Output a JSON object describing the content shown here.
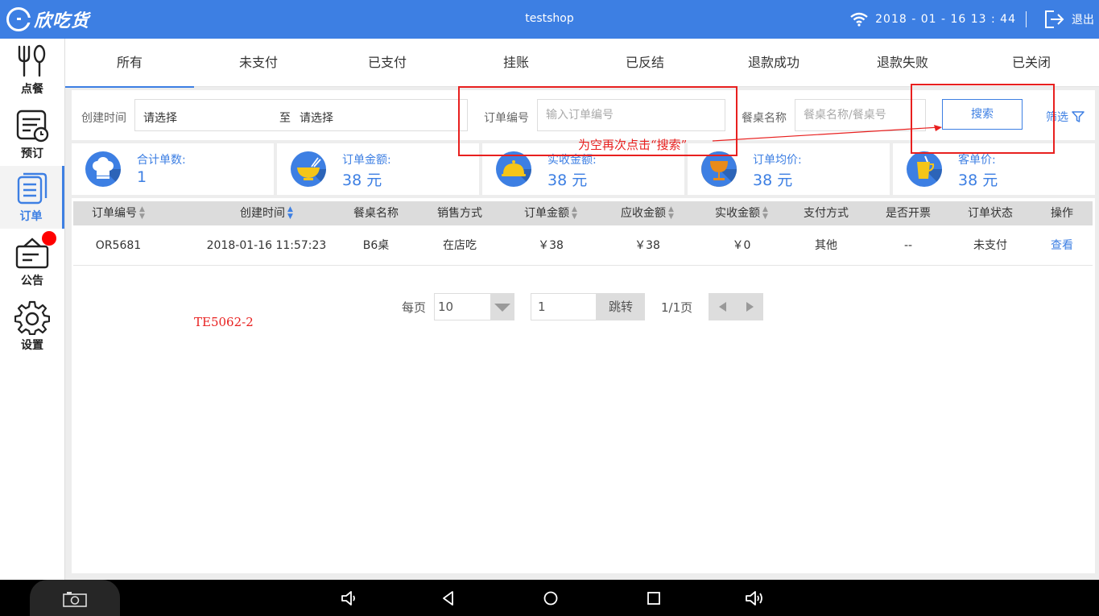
{
  "header": {
    "app_name": "欣吃货",
    "shop_name": "testshop",
    "datetime": "2018 - 01 - 16  13 : 44",
    "exit_label": "退出"
  },
  "sidebar": {
    "items": [
      {
        "label": "点餐",
        "icon": "fork-spoon-icon"
      },
      {
        "label": "预订",
        "icon": "reservation-clock-icon"
      },
      {
        "label": "订单",
        "icon": "order-list-icon",
        "active": true
      },
      {
        "label": "公告",
        "icon": "notice-board-icon",
        "has_badge": true
      },
      {
        "label": "设置",
        "icon": "gear-icon"
      }
    ]
  },
  "tabs": [
    {
      "label": "所有",
      "active": true
    },
    {
      "label": "未支付"
    },
    {
      "label": "已支付"
    },
    {
      "label": "挂账"
    },
    {
      "label": "已反结"
    },
    {
      "label": "退款成功"
    },
    {
      "label": "退款失败"
    },
    {
      "label": "已关闭"
    }
  ],
  "filter": {
    "create_time_label": "创建时间",
    "start_value": "请选择",
    "to_label": "至",
    "end_value": "请选择",
    "order_no_label": "订单编号",
    "order_no_placeholder": "输入订单编号",
    "table_label": "餐桌名称",
    "table_placeholder": "餐桌名称/餐桌号",
    "search_label": "搜索",
    "filter_label": "筛选"
  },
  "stats": [
    {
      "title": "合计单数:",
      "value": "1",
      "icon": "chef-hat-icon"
    },
    {
      "title": "订单金额:",
      "value": "38 元",
      "icon": "bowl-icon"
    },
    {
      "title": "实收金额:",
      "value": "38 元",
      "icon": "cloche-icon"
    },
    {
      "title": "订单均价:",
      "value": "38 元",
      "icon": "goblet-icon"
    },
    {
      "title": "客单价:",
      "value": "38 元",
      "icon": "cup-icon"
    }
  ],
  "table": {
    "columns": [
      "订单编号",
      "创建时间",
      "餐桌名称",
      "销售方式",
      "订单金额",
      "应收金额",
      "实收金额",
      "支付方式",
      "是否开票",
      "订单状态",
      "操作"
    ],
    "rows": [
      [
        "OR5681",
        "2018-01-16 11:57:23",
        "B6桌",
        "在店吃",
        "￥38",
        "￥38",
        "￥0",
        "其他",
        "--",
        "未支付",
        "查看"
      ]
    ]
  },
  "pager": {
    "per_page_label": "每页",
    "per_page_value": "10",
    "page_input": "1",
    "jump_label": "跳转",
    "page_info": "1/1页"
  },
  "annotations": {
    "note": "为空再次点击“搜索”",
    "test_code": "TE5062-2"
  },
  "colors": {
    "accent": "#3d7fe3",
    "annotation_red": "#e8201f",
    "badge": "#ff0000"
  }
}
